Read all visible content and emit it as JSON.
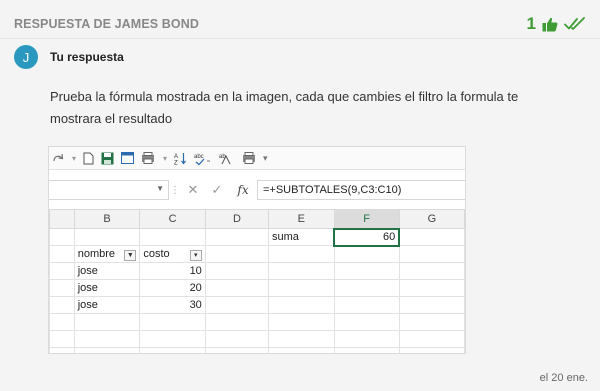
{
  "header": {
    "title": "RESPUESTA DE JAMES BOND",
    "like_count": "1",
    "accent": "#3f9c35"
  },
  "answer": {
    "avatar_letter": "J",
    "label": "Tu respuesta",
    "text": "Prueba la fórmula mostrada en la imagen, cada que cambies el filtro la formula te mostrara el resultado"
  },
  "excel": {
    "qat_more": "▾",
    "fx_label": "fx",
    "formula": "=+SUBTOTALES(9,C3:C10)",
    "columns": [
      "B",
      "C",
      "D",
      "E",
      "F",
      "G"
    ],
    "selected_column": "F",
    "rows": [
      [
        "",
        "",
        "",
        "suma",
        "60",
        ""
      ],
      [
        "nombre",
        "costo",
        "",
        "",
        "",
        ""
      ],
      [
        "jose",
        "10",
        "",
        "",
        "",
        ""
      ],
      [
        "jose",
        "20",
        "",
        "",
        "",
        ""
      ],
      [
        "jose",
        "30",
        "",
        "",
        "",
        ""
      ],
      [
        "",
        "",
        "",
        "",
        "",
        ""
      ],
      [
        "",
        "",
        "",
        "",
        "",
        ""
      ],
      [
        "",
        "",
        "",
        "",
        "",
        ""
      ]
    ]
  },
  "footer": {
    "timestamp": "el 20 ene."
  }
}
